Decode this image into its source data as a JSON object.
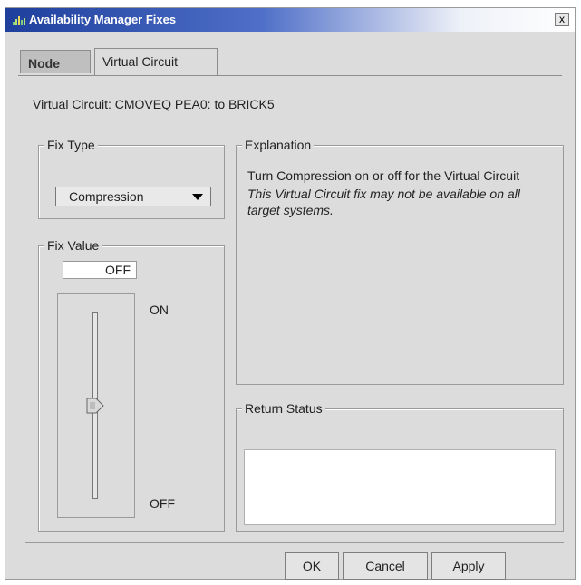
{
  "window": {
    "title": "Availability Manager Fixes",
    "close_label": "x"
  },
  "tabs": [
    {
      "label": "Node",
      "active": false
    },
    {
      "label": "Virtual Circuit",
      "active": true
    }
  ],
  "header": {
    "vc_title": "Virtual Circuit: CMOVEQ PEA0: to BRICK5"
  },
  "fix_type": {
    "label": "Fix Type",
    "selected": "Compression"
  },
  "fix_value": {
    "label": "Fix Value",
    "value": "OFF",
    "slider_top_label": "ON",
    "slider_bottom_label": "OFF",
    "slider_level": 0.5
  },
  "explanation": {
    "label": "Explanation",
    "text": "Turn Compression on or off for the Virtual Circuit",
    "note": "This Virtual Circuit fix may not be available on all target systems."
  },
  "return_status": {
    "label": "Return Status"
  },
  "buttons": {
    "ok": "OK",
    "cancel": "Cancel",
    "apply": "Apply"
  }
}
